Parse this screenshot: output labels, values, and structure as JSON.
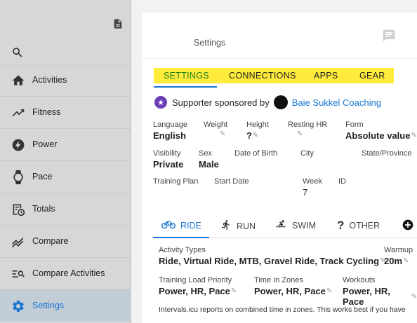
{
  "sidebar": {
    "items": [
      {
        "label": "Activities",
        "icon": "home-icon"
      },
      {
        "label": "Fitness",
        "icon": "trending-up-icon"
      },
      {
        "label": "Power",
        "icon": "power-icon"
      },
      {
        "label": "Pace",
        "icon": "watch-icon"
      },
      {
        "label": "Totals",
        "icon": "totals-icon"
      },
      {
        "label": "Compare",
        "icon": "compare-icon"
      },
      {
        "label": "Compare Activities",
        "icon": "compare-activities-icon"
      },
      {
        "label": "Settings",
        "icon": "gear-icon",
        "active": true
      }
    ],
    "active_color": "#1976d2"
  },
  "header": {
    "title": "Settings"
  },
  "tabs": [
    {
      "label": "SETTINGS",
      "active": true
    },
    {
      "label": "CONNECTIONS"
    },
    {
      "label": "APPS"
    },
    {
      "label": "GEAR"
    }
  ],
  "sponsor": {
    "text": "Supporter sponsored by",
    "coach": "Baie Sukkel Coaching"
  },
  "fields": {
    "language": {
      "label": "Language",
      "value": "English"
    },
    "weight": {
      "label": "Weight"
    },
    "height": {
      "label": "Height",
      "value": "?"
    },
    "resting_hr": {
      "label": "Resting HR"
    },
    "form": {
      "label": "Form",
      "value": "Absolute value"
    },
    "visibility": {
      "label": "Visibility",
      "value": "Private"
    },
    "sex": {
      "label": "Sex",
      "value": "Male"
    },
    "dob": {
      "label": "Date of Birth"
    },
    "city": {
      "label": "City"
    },
    "state": {
      "label": "State/Province"
    },
    "training_plan": {
      "label": "Training Plan"
    },
    "start_date": {
      "label": "Start Date"
    },
    "week": {
      "label": "Week",
      "value": "7"
    },
    "id": {
      "label": "ID"
    }
  },
  "sport_tabs": [
    {
      "label": "RIDE",
      "icon": "bike-icon",
      "active": true
    },
    {
      "label": "RUN",
      "icon": "run-icon"
    },
    {
      "label": "SWIM",
      "icon": "swim-icon"
    },
    {
      "label": "OTHER",
      "icon": "question-icon"
    }
  ],
  "ride": {
    "activity_types": {
      "label": "Activity Types",
      "value": "Ride, Virtual Ride, MTB, Gravel Ride, Track Cycling"
    },
    "warmup": {
      "label": "Warmup",
      "value": "20m"
    },
    "training_load_priority": {
      "label": "Training Load Priority",
      "value": "Power, HR, Pace"
    },
    "time_in_zones": {
      "label": "Time In Zones",
      "value": "Power, HR, Pace"
    },
    "workouts": {
      "label": "Workouts",
      "value": "Power, HR, Pace"
    },
    "note": "Intervals.icu reports on combined time in zones. This works best if you have"
  },
  "colors": {
    "tab_highlight": "#ffeb3b",
    "active_tab_text": "#1b7f1b",
    "link": "#1976d2",
    "sponsor_star": "#6a3fb5"
  }
}
